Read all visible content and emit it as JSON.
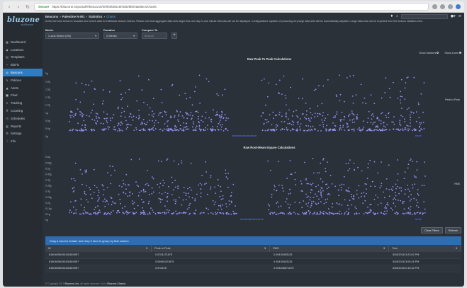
{
  "browser": {
    "secure_label": "Secure",
    "url": "https://bluzone.io/portal/#/beacons/0/0f40b0819/4082fd0/statistics/charts"
  },
  "brand": {
    "name": "bluzone",
    "sub": "by Bluzone"
  },
  "sidebar": {
    "items": [
      {
        "label": "Dashboard",
        "icon": "▦"
      },
      {
        "label": "Locations",
        "icon": "◆"
      },
      {
        "label": "Templates",
        "icon": "▤"
      },
      {
        "label": "BluFis",
        "icon": "⌁"
      },
      {
        "label": "Beacons",
        "icon": "◎",
        "active": true
      },
      {
        "label": "Policies",
        "icon": "✎"
      },
      {
        "label": "Alerts",
        "icon": "▲"
      },
      {
        "label": "Fleet",
        "icon": "■"
      },
      {
        "label": "Tracking",
        "icon": "⌖"
      },
      {
        "label": "Counting",
        "icon": "#"
      },
      {
        "label": "Schedules",
        "icon": "◷"
      },
      {
        "label": "Reports",
        "icon": "▥"
      },
      {
        "label": "Settings",
        "icon": "⚙"
      },
      {
        "label": "Info",
        "icon": "i"
      }
    ]
  },
  "breadcrumb": {
    "a": "Beacons",
    "b": "Palestine N-W1",
    "c": "Statistics",
    "current": "Charts"
  },
  "description": "At the line form below to visualize time series data for individual beacon metrics. Please note that aggregate data sets larger than one day in one minute intervals will not be displayed. Configurations capable of producing very large data sets will be automatically adjusted. Large data sets can be exported from the beacon statistics view.",
  "controls": {
    "metric": {
      "label": "Metric",
      "value": "X-axis Motion (Hill)"
    },
    "duration": {
      "label": "Duration",
      "value": "2 Weeks"
    },
    "compare": {
      "label": "Compare To",
      "placeholder": "Beacon"
    }
  },
  "toggles": {
    "markers": "Show Markers",
    "lines": "Show Lines"
  },
  "chart_data": [
    {
      "type": "scatter",
      "title": "Raw Peak To Peak Calculations",
      "series": [
        {
          "name": "Peak to Peak",
          "color": "#8f8ff4"
        }
      ],
      "yticks": [
        "2g",
        "1.8g",
        "1.6g",
        "1.4g",
        "1.2g",
        "1g",
        "0.8g",
        "0.6g",
        "0g"
      ],
      "ylim": [
        0,
        2
      ]
    },
    {
      "type": "scatter",
      "title": "Raw Root-Mean-Square Calculations",
      "series": [
        {
          "name": "RMS",
          "color": "#8f8ff4"
        }
      ],
      "yticks": [
        "0.6g",
        "0.55g",
        "0.5g",
        "0.45g",
        "0.4g",
        "0.35g",
        "0.3g",
        "0.25g",
        "0.2g",
        "0.15g",
        "0.1g",
        "0g"
      ],
      "ylim": [
        0,
        0.6
      ]
    }
  ],
  "buttons": {
    "clear_filters": "Clear Filters",
    "refresh": "Refresh"
  },
  "grid": {
    "group_hint": "Drag a column header and drop it here to group by that column",
    "columns": [
      "ID",
      "Peak to Peak",
      "RMS",
      "Time"
    ],
    "rows": [
      [
        "81804058193430824957",
        "0.0761171875",
        "0.00439453125",
        "5/28/2018 3:23:02 PM"
      ],
      [
        "81804058193430824957",
        "0.06982421875",
        "0.00439453125",
        "5/28/2018 3:00:24 PM"
      ],
      [
        "81804058193430824957",
        "0.078125",
        "0.004638671875",
        "5/28/2018 2:43:42 PM"
      ]
    ]
  },
  "footer": {
    "prefix": "© Copyright 2017",
    "company": "Bluzone, Inc.",
    "rights": "All rights reserved. Go to",
    "link": "Bluzone Classic"
  }
}
